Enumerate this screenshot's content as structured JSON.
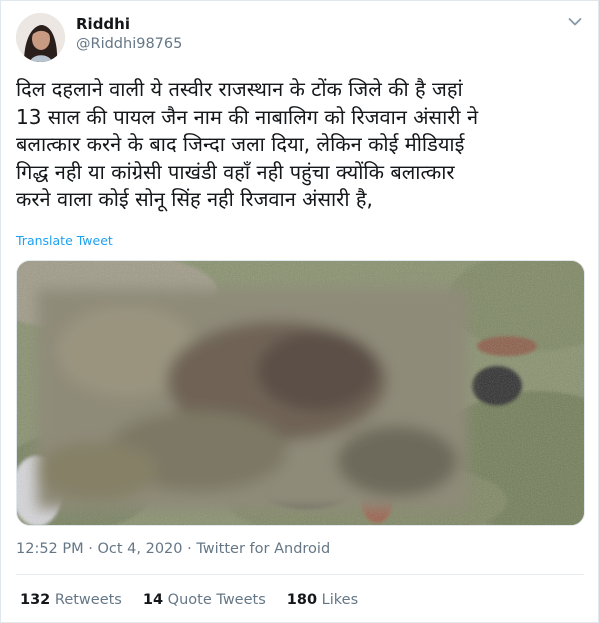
{
  "user": {
    "name": "Riddhi",
    "handle": "@Riddhi98765"
  },
  "tweet": {
    "text": "दिल दहलाने वाली ये तस्वीर राजस्थान के टोंक जिले की है जहां\n13 साल की पायल जैन नाम की नाबालिग को रिजवान अंसारी ने\nबलात्कार करने के बाद जिन्दा जला दिया, लेकिन कोई मीडियाई\nगिद्ध नही या कांग्रेसी पाखंडी वहाँ नही पहुंचा क्योंकि बलात्कार\nकरने वाला कोई सोनू सिंह नही रिजवान अंसारी है,",
    "translate_label": "Translate Tweet",
    "meta": "12:52 PM · Oct 4, 2020 · Twitter for Android"
  },
  "stats": {
    "retweets_count": "132",
    "retweets_label": "Retweets",
    "quote_count": "14",
    "quote_label": "Quote Tweets",
    "likes_count": "180",
    "likes_label": "Likes"
  },
  "colors": {
    "link": "#1da1f2",
    "secondary_text": "#657786",
    "primary_text": "#14171a",
    "border": "#e1e8ed"
  },
  "icons": [
    "avatar-photo",
    "chevron-down-icon",
    "blurred-photo"
  ]
}
